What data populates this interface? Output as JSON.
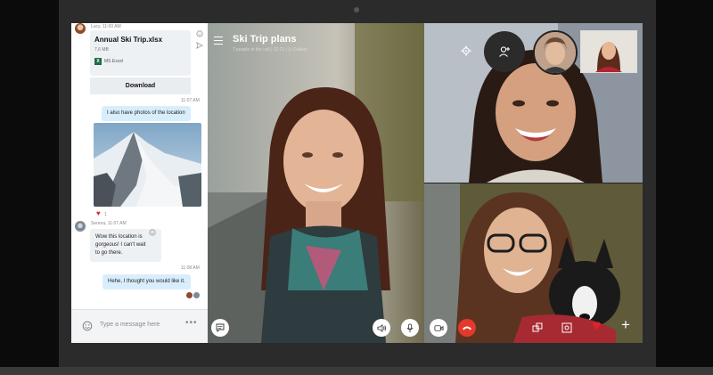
{
  "chat": {
    "file_sender_meta": "Lucy, 11:00 AM",
    "file_name": "Annual Ski Trip.xlsx",
    "file_size": "7,6 MB",
    "file_app": "MS Excel",
    "download_label": "Download",
    "time_1": "11:07 AM",
    "msg_1": "I also have photos of the location",
    "heart_count": "1",
    "serena_meta": "Serena, 11:07 AM",
    "msg_2_line1": "Wow this location is",
    "msg_2_line2": "gorgeous! I can't wait",
    "msg_2_line3": "to go there.",
    "time_2": "11:08 AM",
    "msg_3": "Hehe, I thought you would like it.",
    "composer_placeholder": "Type a message here"
  },
  "call": {
    "title": "Ski Trip plans",
    "subtitle": "7 people in the call | 02:21 | ⊡ Gallery"
  },
  "colors": {
    "accent_blue": "#d9eefc",
    "hangup_red": "#e3392d",
    "heart_red": "#e0242b"
  }
}
